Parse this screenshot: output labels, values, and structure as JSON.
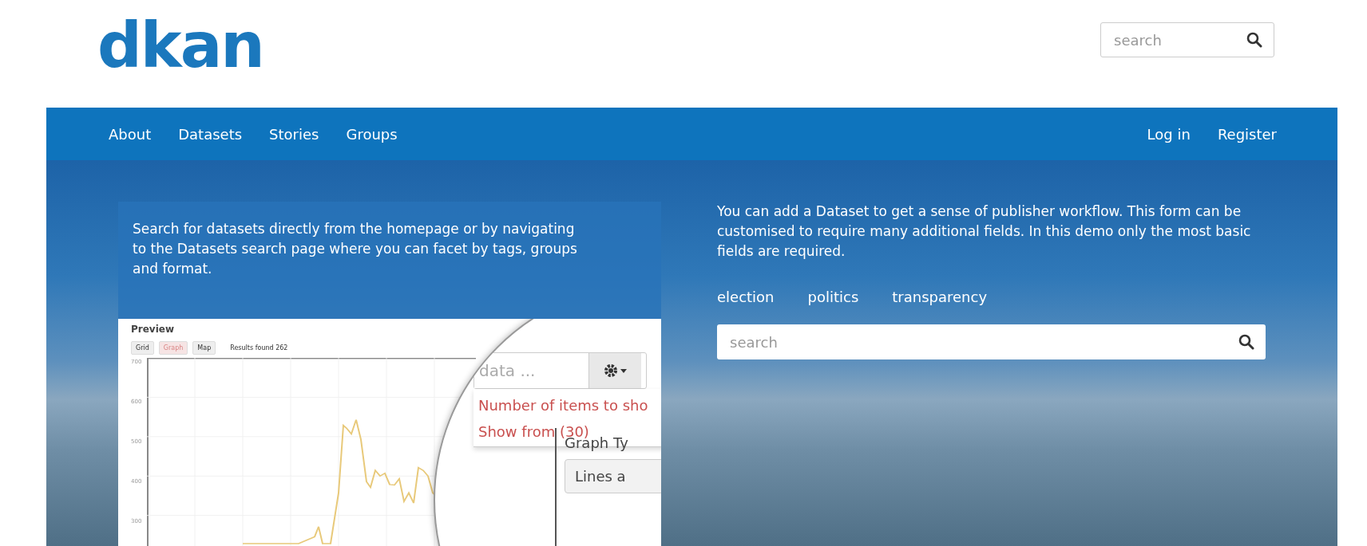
{
  "logo": {
    "text": "dkan"
  },
  "header_search": {
    "placeholder": "search"
  },
  "nav": {
    "left": [
      {
        "label": "About"
      },
      {
        "label": "Datasets"
      },
      {
        "label": "Stories"
      },
      {
        "label": "Groups"
      }
    ],
    "right": [
      {
        "label": "Log in"
      },
      {
        "label": "Register"
      }
    ]
  },
  "hero": {
    "left_panel": {
      "text": "Search for datasets directly from the homepage or by navigating to the Datasets search page where you can facet by tags, groups and format.",
      "preview": {
        "title": "Preview",
        "view_buttons": [
          {
            "label": "Grid",
            "selected": false
          },
          {
            "label": "Graph",
            "selected": true
          },
          {
            "label": "Map",
            "selected": false
          }
        ],
        "results": "Results found 262",
        "y_axis_labels": [
          "700",
          "600",
          "500",
          "400",
          "300"
        ],
        "magnifier": {
          "search_placeholder": "data ...",
          "menu_items": [
            "Number of items to sho",
            "Show from (30)"
          ],
          "graph_type_label": "Graph Ty",
          "graph_type_value": "Lines a"
        }
      }
    },
    "right_panel": {
      "text": "You can add a Dataset to get a sense of publisher workflow. This form can be customised to require many additional fields. In this demo only the most basic fields are required.",
      "tags": [
        {
          "label": "election"
        },
        {
          "label": "politics"
        },
        {
          "label": "transparency"
        }
      ],
      "search": {
        "placeholder": "search"
      }
    }
  }
}
